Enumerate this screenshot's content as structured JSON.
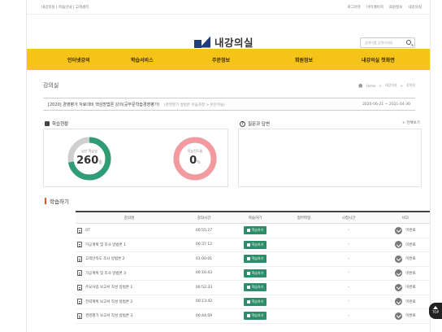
{
  "topbar": {
    "left": "내강의실 | 학습안내 | 고객센터",
    "links": [
      "로그아웃",
      "마이페이지",
      "회원정보",
      "내강의실"
    ]
  },
  "logo": {
    "text": "내강의실"
  },
  "search": {
    "placeholder": "검색어를 입력하세요"
  },
  "nav": {
    "items": [
      "인터넷강의",
      "학습서비스",
      "주문정보",
      "회원정보",
      "내강의실 첫화면"
    ]
  },
  "page": {
    "title": "강의실",
    "breadcrumb": [
      "Home",
      "내강의실",
      "강의실"
    ]
  },
  "course": {
    "title": "[2020] 경영평가 자료대비 핵심방법론 강의(공부문학습경영평가)",
    "subtitle": "(경영평가 방법론 학습과정 > 본문학습)",
    "dates": "2020-06-21 ~ 2021-04-30"
  },
  "progress": {
    "heading": "학습현황",
    "cards": [
      {
        "label": "남은 학습일",
        "value": "260",
        "unit": "일",
        "fraction": 0.72,
        "color": "#2e9c74"
      },
      {
        "label": "학습진도율",
        "value": "0",
        "unit": "%",
        "fraction": 1.0,
        "color": "#f39aa0"
      }
    ]
  },
  "qna": {
    "heading": "질문과 답변",
    "more": "+ 전체보기"
  },
  "learn": {
    "heading": "학습하기",
    "columns": [
      "강의명",
      "강의시간",
      "학습하기",
      "첨부파일",
      "시청시간",
      "비고"
    ],
    "rows": [
      {
        "name": "OT",
        "time": "00:55:27",
        "btn": "학습하기",
        "file": "",
        "watch": "-",
        "note": "미완료"
      },
      {
        "name": "가공계획 및 조사 방법론 1",
        "time": "00:37:12",
        "btn": "학습하기",
        "file": "",
        "watch": "-",
        "note": "미완료"
      },
      {
        "name": "고객만족도 조사 방법론 2",
        "time": "01:00:01",
        "btn": "학습하기",
        "file": "",
        "watch": "-",
        "note": "미완료"
      },
      {
        "name": "가공계획 및 조사 방법론 3",
        "time": "00:16:43",
        "btn": "학습하기",
        "file": "",
        "watch": "-",
        "note": "미완료"
      },
      {
        "name": "주요사업 보고서 작성 방법론 1",
        "time": "00:52:33",
        "btn": "학습하기",
        "file": "",
        "watch": "-",
        "note": "미완료"
      },
      {
        "name": "전략계획 보고서 작성 방법론 2",
        "time": "00:13:42",
        "btn": "학습하기",
        "file": "",
        "watch": "-",
        "note": "미완료"
      },
      {
        "name": "경영평가 보고서 작성 방법론 3",
        "time": "00:44:09",
        "btn": "학습하기",
        "file": "",
        "watch": "-",
        "note": "미완료"
      }
    ]
  },
  "scroll_top": {
    "label": "TOP"
  }
}
